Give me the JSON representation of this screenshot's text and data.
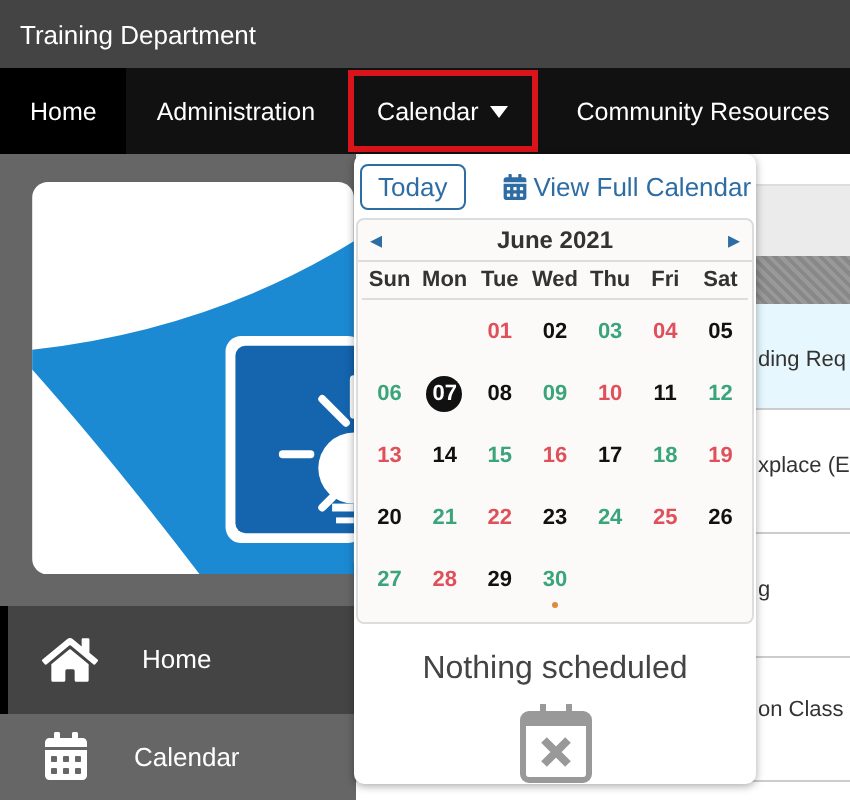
{
  "window": {
    "title": "Training Department"
  },
  "nav": [
    {
      "label": "Home",
      "selected": false,
      "dropdown": false,
      "dark": true
    },
    {
      "label": "Administration",
      "selected": false,
      "dropdown": false,
      "dark": false
    },
    {
      "label": "Calendar",
      "selected": true,
      "dropdown": true,
      "dark": false
    },
    {
      "label": "Community Resources",
      "selected": false,
      "dropdown": false,
      "dark": false
    }
  ],
  "sidebar": {
    "items": [
      {
        "label": "Home",
        "selected": true
      },
      {
        "label": "Calendar",
        "selected": false
      }
    ]
  },
  "content": {
    "rows": [
      {
        "text": "ding Req",
        "highlighted": true
      },
      {
        "text": "xplace (E",
        "highlighted": false
      },
      {
        "text": "g",
        "highlighted": false
      },
      {
        "text": "on Class",
        "highlighted": false
      }
    ]
  },
  "calendar_popup": {
    "today_button": "Today",
    "full_calendar_link": "View Full Calendar",
    "prev": "◂",
    "next": "▸",
    "month": "June 2021",
    "weekdays": [
      "Sun",
      "Mon",
      "Tue",
      "Wed",
      "Thu",
      "Fri",
      "Sat"
    ],
    "weeks": [
      [
        {
          "day": "01",
          "color": "#e0505a",
          "selected": false,
          "event": false
        },
        {
          "day": "02",
          "color": "#111111",
          "selected": false,
          "event": false
        },
        {
          "day": "03",
          "color": "#3aa57a",
          "selected": false,
          "event": false
        },
        {
          "day": "04",
          "color": "#e0505a",
          "selected": false,
          "event": false
        },
        {
          "day": "05",
          "color": "#111111",
          "selected": false,
          "event": false
        }
      ],
      [
        {
          "day": "06",
          "color": "#3aa57a",
          "selected": false,
          "event": false
        },
        {
          "day": "07",
          "color": "#111111",
          "selected": true,
          "event": false
        },
        {
          "day": "08",
          "color": "#111111",
          "selected": false,
          "event": false
        },
        {
          "day": "09",
          "color": "#3aa57a",
          "selected": false,
          "event": false
        },
        {
          "day": "10",
          "color": "#e0505a",
          "selected": false,
          "event": false
        },
        {
          "day": "11",
          "color": "#111111",
          "selected": false,
          "event": false
        },
        {
          "day": "12",
          "color": "#3aa57a",
          "selected": false,
          "event": false
        }
      ],
      [
        {
          "day": "13",
          "color": "#e0505a",
          "selected": false,
          "event": false
        },
        {
          "day": "14",
          "color": "#111111",
          "selected": false,
          "event": false
        },
        {
          "day": "15",
          "color": "#3aa57a",
          "selected": false,
          "event": false
        },
        {
          "day": "16",
          "color": "#e0505a",
          "selected": false,
          "event": false
        },
        {
          "day": "17",
          "color": "#111111",
          "selected": false,
          "event": false
        },
        {
          "day": "18",
          "color": "#3aa57a",
          "selected": false,
          "event": false
        },
        {
          "day": "19",
          "color": "#e0505a",
          "selected": false,
          "event": false
        }
      ],
      [
        {
          "day": "20",
          "color": "#111111",
          "selected": false,
          "event": false
        },
        {
          "day": "21",
          "color": "#3aa57a",
          "selected": false,
          "event": false
        },
        {
          "day": "22",
          "color": "#e0505a",
          "selected": false,
          "event": false
        },
        {
          "day": "23",
          "color": "#111111",
          "selected": false,
          "event": false
        },
        {
          "day": "24",
          "color": "#3aa57a",
          "selected": false,
          "event": false
        },
        {
          "day": "25",
          "color": "#e0505a",
          "selected": false,
          "event": false
        },
        {
          "day": "26",
          "color": "#111111",
          "selected": false,
          "event": false
        }
      ],
      [
        {
          "day": "27",
          "color": "#3aa57a",
          "selected": false,
          "event": false
        },
        {
          "day": "28",
          "color": "#e0505a",
          "selected": false,
          "event": false
        },
        {
          "day": "29",
          "color": "#111111",
          "selected": false,
          "event": false
        },
        {
          "day": "30",
          "color": "#3aa57a",
          "selected": false,
          "event": true
        }
      ]
    ],
    "empty_message": "Nothing scheduled"
  }
}
